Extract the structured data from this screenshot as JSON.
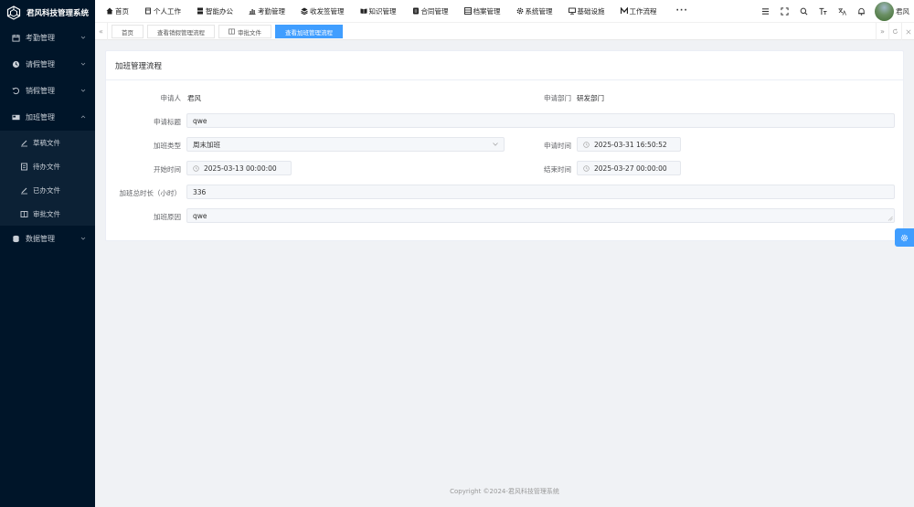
{
  "brand": {
    "title": "君风科技管理系统"
  },
  "sidebar": {
    "items": [
      {
        "label": "考勤管理",
        "icon": "calendar-icon"
      },
      {
        "label": "请假管理",
        "icon": "clock-icon"
      },
      {
        "label": "销假管理",
        "icon": "undo-icon"
      },
      {
        "label": "加班管理",
        "icon": "card-icon",
        "expanded": true
      }
    ],
    "subitems": [
      {
        "label": "草稿文件",
        "icon": "pen-icon"
      },
      {
        "label": "待办文件",
        "icon": "document-icon"
      },
      {
        "label": "已办文件",
        "icon": "pen-icon"
      },
      {
        "label": "审批文件",
        "icon": "book-icon"
      }
    ],
    "last_item": {
      "label": "数据管理",
      "icon": "database-icon"
    }
  },
  "topnav": {
    "items": [
      {
        "label": "首页",
        "icon": "home-icon"
      },
      {
        "label": "个人工作",
        "icon": "cup-icon"
      },
      {
        "label": "智能办公",
        "icon": "office-icon"
      },
      {
        "label": "考勤管理",
        "icon": "chart-icon"
      },
      {
        "label": "收发签管理",
        "icon": "layers-icon"
      },
      {
        "label": "知识管理",
        "icon": "open-book-icon"
      },
      {
        "label": "合同管理",
        "icon": "contract-icon"
      },
      {
        "label": "档案管理",
        "icon": "archive-icon"
      },
      {
        "label": "系统管理",
        "icon": "gear-icon"
      },
      {
        "label": "基础设施",
        "icon": "monitor-icon"
      },
      {
        "label": "工作流程",
        "icon": "workflow-icon"
      }
    ],
    "more": "···"
  },
  "user": {
    "name": "君风"
  },
  "tabs": [
    {
      "label": "首页",
      "active": false
    },
    {
      "label": "查看销假管理流程",
      "active": false
    },
    {
      "label": "审批文件",
      "active": false,
      "icon": "book-icon"
    },
    {
      "label": "查看加班管理流程",
      "active": true
    }
  ],
  "form": {
    "title": "加班管理流程",
    "applicant_label": "申请人",
    "applicant_value": "君风",
    "dept_label": "申请部门",
    "dept_value": "研发部门",
    "subject_label": "申请标题",
    "subject_value": "qwe",
    "type_label": "加班类型",
    "type_value": "周末加班",
    "apply_time_label": "申请时间",
    "apply_time_value": "2025-03-31 16:50:52",
    "start_label": "开始时间",
    "start_value": "2025-03-13 00:00:00",
    "end_label": "结束时间",
    "end_value": "2025-03-27 00:00:00",
    "duration_label": "加班总时长（小时）",
    "duration_value": "336",
    "reason_label": "加班原因",
    "reason_value": "qwe"
  },
  "footer": {
    "copyright": "Copyright ©2024-君风科技管理系统"
  }
}
